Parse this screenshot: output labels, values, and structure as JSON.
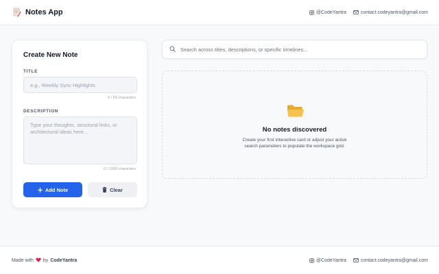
{
  "header": {
    "title": "Notes App",
    "brand_icon": "note-pencil-icon",
    "instagram": "@CodeYantra",
    "email": "contact.codeyantra@gmail.com"
  },
  "create": {
    "heading": "Create New Note",
    "title_label": "TITLE",
    "title_value": "",
    "title_placeholder": "e.g., Weekly Sync Highlights",
    "title_counter": "0 / 50 characters",
    "description_label": "DESCRIPTION",
    "description_value": "",
    "description_placeholder": "Type your thoughts, structural links, or architectural ideas here...",
    "description_counter": "0 / 1000 characters",
    "add_label": "Add Note",
    "clear_label": "Clear"
  },
  "search": {
    "value": "",
    "placeholder": "Search across titles, descriptions, or specific timelines..."
  },
  "empty_state": {
    "icon": "open-folder-icon",
    "title": "No notes discovered",
    "line1": "Create your first interactive card or adjust your active",
    "line2": "search parameters to populate the workspace grid."
  },
  "footer": {
    "made_prefix": "Made with",
    "made_by": "by",
    "author": "CodeYantra",
    "instagram": "@CodeYantra",
    "email": "contact.codeyantra@gmail.com"
  },
  "colors": {
    "primary": "#2563eb",
    "heart": "#e11d48",
    "folder": "#f5b942",
    "background": "#f8f9fb"
  }
}
